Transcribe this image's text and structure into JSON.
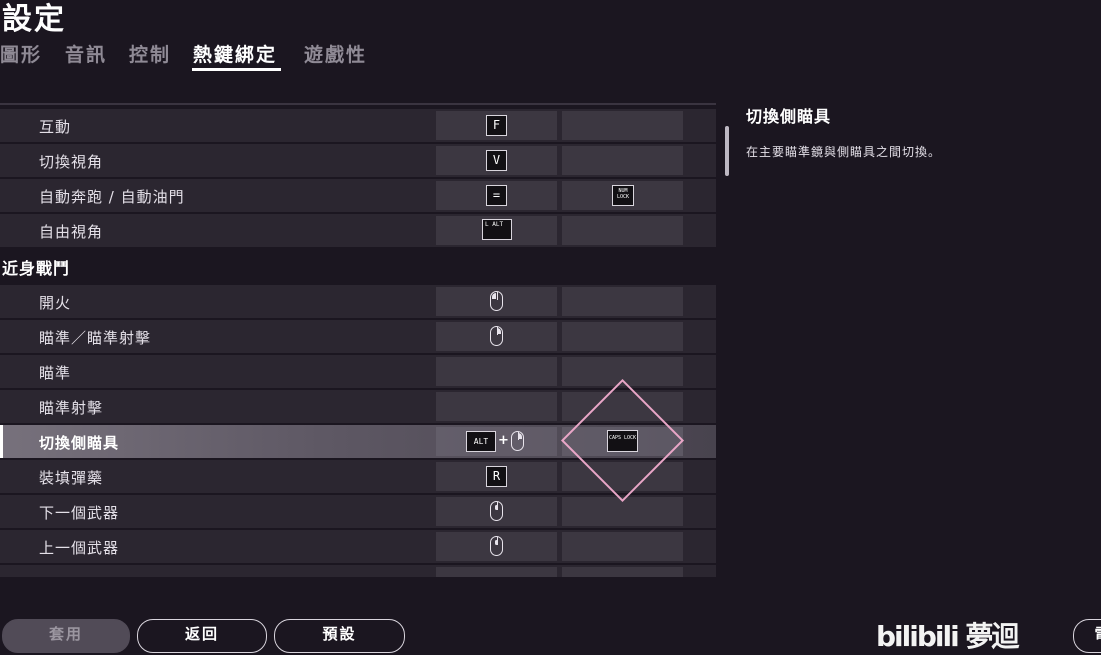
{
  "page": {
    "title": "設定"
  },
  "tabs": [
    "圖形",
    "音訊",
    "控制",
    "熱鍵綁定",
    "遊戲性"
  ],
  "active_tab": "熱鍵綁定",
  "rows_top": [
    {
      "label": "互動",
      "primary": "F",
      "secondary": ""
    },
    {
      "label": "切換視角",
      "primary": "V",
      "secondary": ""
    },
    {
      "label": "自動奔跑 / 自動油門",
      "primary": "=",
      "secondary": "NUM LOCK"
    },
    {
      "label": "自由視角",
      "primary": "L ALT",
      "secondary": ""
    }
  ],
  "section": {
    "title": "近身戰鬥"
  },
  "rows_melee": [
    {
      "label": "開火",
      "primary_icon": "mouse-left-icon",
      "secondary": ""
    },
    {
      "label": "瞄準／瞄準射擊",
      "primary_icon": "mouse-right-icon",
      "secondary": ""
    },
    {
      "label": "瞄準",
      "primary": "",
      "secondary": ""
    },
    {
      "label": "瞄準射擊",
      "primary": "",
      "secondary": ""
    },
    {
      "label": "切換側瞄具",
      "primary": "ALT",
      "primary_plus": "+",
      "primary_icon": "mouse-right-icon",
      "secondary": "CAPS LOCK",
      "selected": true
    },
    {
      "label": "裝填彈藥",
      "primary": "R",
      "secondary": ""
    },
    {
      "label": "下一個武器",
      "primary_icon": "mouse-wheel-down-icon",
      "secondary": ""
    },
    {
      "label": "上一個武器",
      "primary_icon": "mouse-wheel-up-icon",
      "secondary": ""
    }
  ],
  "detail": {
    "title": "切換側瞄具",
    "description": "在主要瞄準鏡與側瞄具之間切換。"
  },
  "footer": {
    "apply": "套用",
    "back": "返回",
    "default": "預設",
    "more": "電"
  },
  "watermark": "bilibili 夢迴",
  "colors": {
    "selection_diamond": "#e9a6c7",
    "background": "#1b1620",
    "row": "#2b2630",
    "cell": "#3c3741"
  }
}
